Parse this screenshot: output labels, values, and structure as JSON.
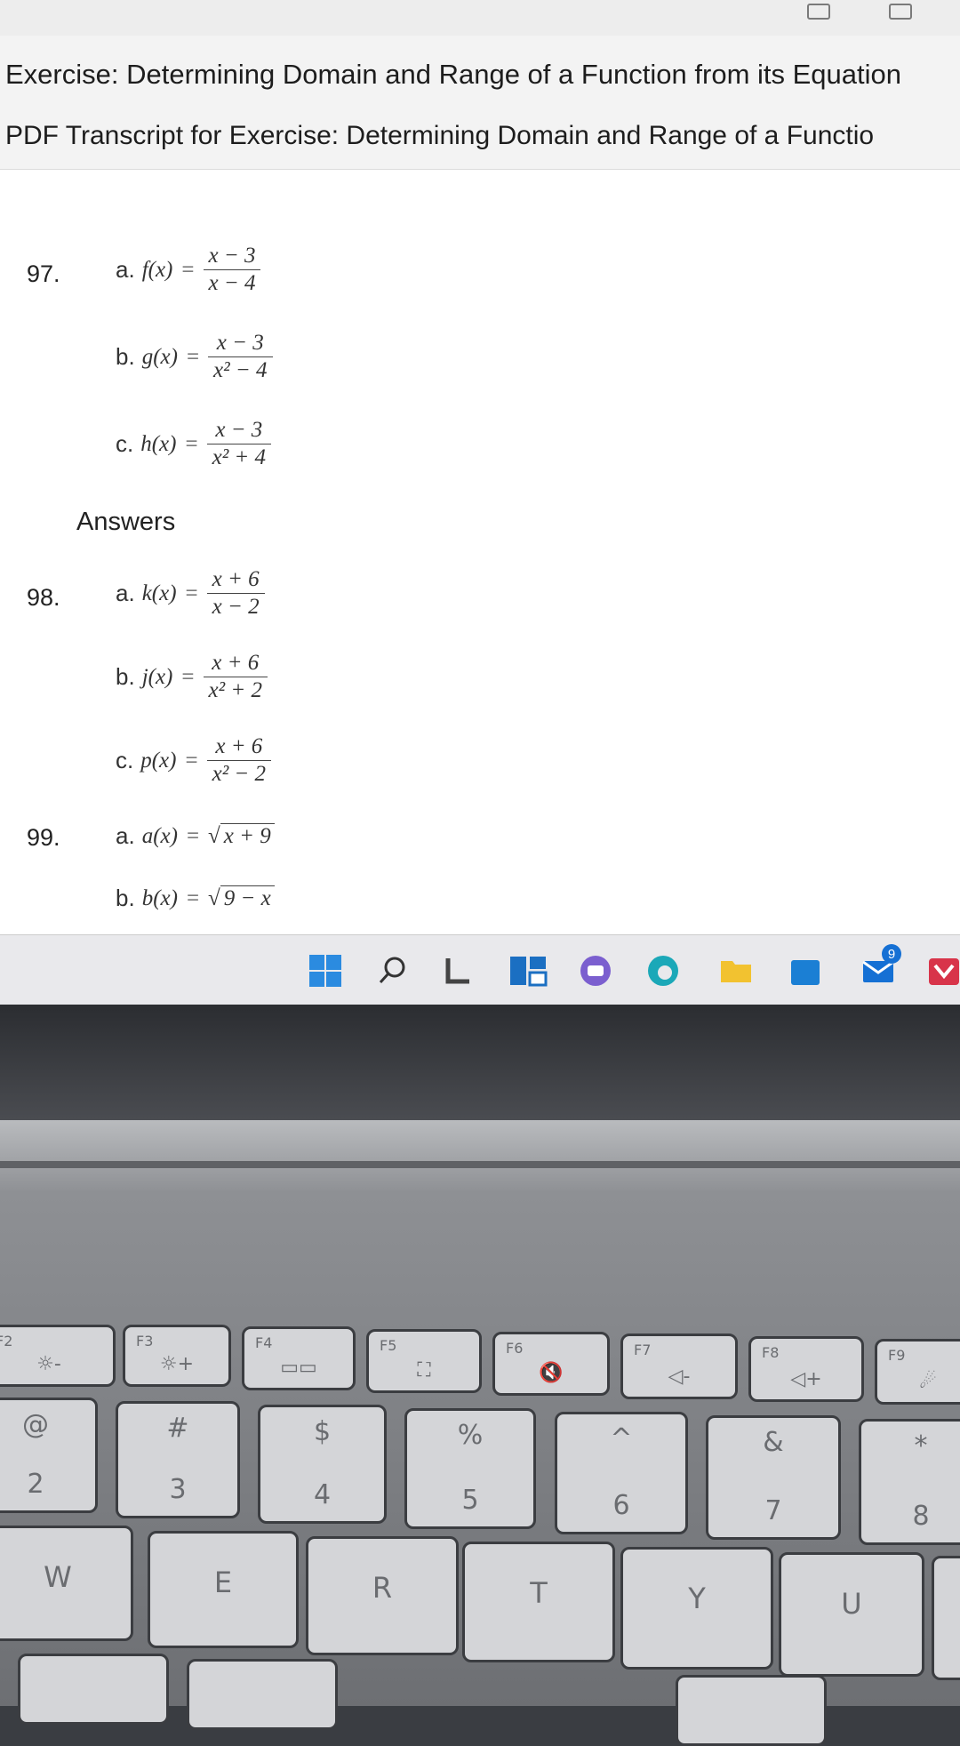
{
  "header": {
    "title": "Exercise: Determining Domain and Range of a Function from its Equation",
    "subtitle": "PDF Transcript for Exercise: Determining Domain and Range of a Functio"
  },
  "exercises": {
    "p97": {
      "number": "97.",
      "a": {
        "label": "a.",
        "fn": "f(x)",
        "eq": "=",
        "num": "x − 3",
        "den": "x − 4"
      },
      "b": {
        "label": "b.",
        "fn": "g(x)",
        "eq": "=",
        "num": "x − 3",
        "den": "x² − 4"
      },
      "c": {
        "label": "c.",
        "fn": "h(x)",
        "eq": "=",
        "num": "x − 3",
        "den": "x² + 4"
      }
    },
    "answers_label": "Answers",
    "p98": {
      "number": "98.",
      "a": {
        "label": "a.",
        "fn": "k(x)",
        "eq": "=",
        "num": "x + 6",
        "den": "x − 2"
      },
      "b": {
        "label": "b.",
        "fn": "j(x)",
        "eq": "=",
        "num": "x + 6",
        "den": "x² + 2"
      },
      "c": {
        "label": "c.",
        "fn": "p(x)",
        "eq": "=",
        "num": "x + 6",
        "den": "x² − 2"
      }
    },
    "p99": {
      "number": "99.",
      "a": {
        "label": "a.",
        "fn": "a(x)",
        "eq": "=",
        "root_sign": "√",
        "radicand": "x + 9"
      },
      "b": {
        "label": "b.",
        "fn": "b(x)",
        "eq": "=",
        "root_sign": "√",
        "radicand": "9 − x"
      }
    }
  },
  "taskbar": {
    "icons": [
      "windows-start-icon",
      "search-icon",
      "widgets-icon",
      "task-view-icon",
      "chat-icon",
      "edge-browser-icon",
      "file-explorer-icon",
      "store-icon",
      "mail-icon",
      "app-icon"
    ],
    "mail_badge": "9",
    "colors": {
      "windows": "#2b8be0",
      "edge": "#1ba8b8",
      "explorer": "#f2c230",
      "mail": "#1570d4",
      "app": "#d8344a"
    }
  },
  "keyboard": {
    "fn_row": [
      {
        "fl": "F2",
        "icon": "☼-"
      },
      {
        "fl": "F3",
        "icon": "☼+"
      },
      {
        "fl": "F4",
        "icon": "▭▭"
      },
      {
        "fl": "F5",
        "icon": "⛶"
      },
      {
        "fl": "F6",
        "icon": "🔇"
      },
      {
        "fl": "F7",
        "icon": "◁-"
      },
      {
        "fl": "F8",
        "icon": "◁+"
      },
      {
        "fl": "F9",
        "icon": "☄"
      }
    ],
    "num_row": [
      {
        "top": "@",
        "bot": "2"
      },
      {
        "top": "#",
        "bot": "3"
      },
      {
        "top": "$",
        "bot": "4"
      },
      {
        "top": "%",
        "bot": "5"
      },
      {
        "top": "^",
        "bot": "6"
      },
      {
        "top": "&",
        "bot": "7"
      },
      {
        "top": "*",
        "bot": "8"
      }
    ],
    "letter_row": [
      "W",
      "E",
      "R",
      "T",
      "Y",
      "U"
    ]
  }
}
